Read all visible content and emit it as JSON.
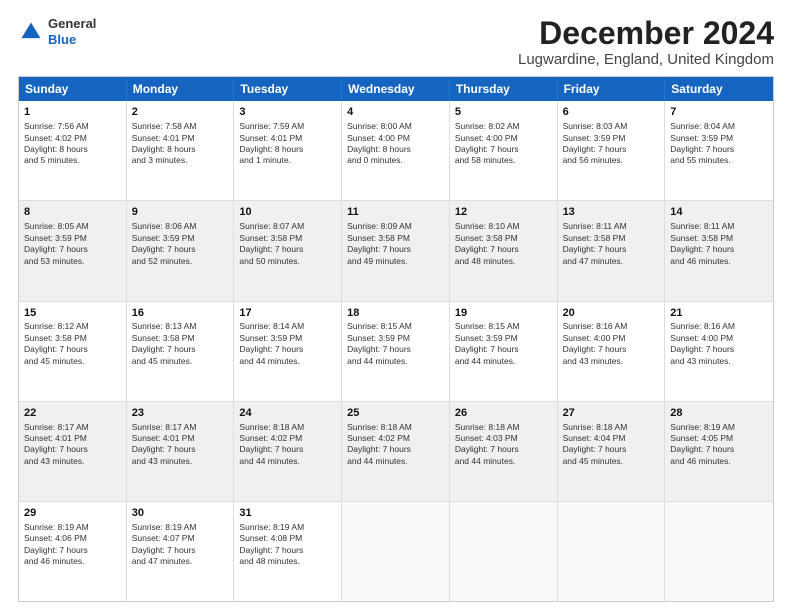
{
  "header": {
    "logo_line1": "General",
    "logo_line2": "Blue",
    "title": "December 2024",
    "subtitle": "Lugwardine, England, United Kingdom"
  },
  "calendar": {
    "weekdays": [
      "Sunday",
      "Monday",
      "Tuesday",
      "Wednesday",
      "Thursday",
      "Friday",
      "Saturday"
    ],
    "rows": [
      [
        {
          "day": "1",
          "lines": [
            "Sunrise: 7:56 AM",
            "Sunset: 4:02 PM",
            "Daylight: 8 hours",
            "and 5 minutes."
          ]
        },
        {
          "day": "2",
          "lines": [
            "Sunrise: 7:58 AM",
            "Sunset: 4:01 PM",
            "Daylight: 8 hours",
            "and 3 minutes."
          ]
        },
        {
          "day": "3",
          "lines": [
            "Sunrise: 7:59 AM",
            "Sunset: 4:01 PM",
            "Daylight: 8 hours",
            "and 1 minute."
          ]
        },
        {
          "day": "4",
          "lines": [
            "Sunrise: 8:00 AM",
            "Sunset: 4:00 PM",
            "Daylight: 8 hours",
            "and 0 minutes."
          ]
        },
        {
          "day": "5",
          "lines": [
            "Sunrise: 8:02 AM",
            "Sunset: 4:00 PM",
            "Daylight: 7 hours",
            "and 58 minutes."
          ]
        },
        {
          "day": "6",
          "lines": [
            "Sunrise: 8:03 AM",
            "Sunset: 3:59 PM",
            "Daylight: 7 hours",
            "and 56 minutes."
          ]
        },
        {
          "day": "7",
          "lines": [
            "Sunrise: 8:04 AM",
            "Sunset: 3:59 PM",
            "Daylight: 7 hours",
            "and 55 minutes."
          ]
        }
      ],
      [
        {
          "day": "8",
          "lines": [
            "Sunrise: 8:05 AM",
            "Sunset: 3:59 PM",
            "Daylight: 7 hours",
            "and 53 minutes."
          ]
        },
        {
          "day": "9",
          "lines": [
            "Sunrise: 8:06 AM",
            "Sunset: 3:59 PM",
            "Daylight: 7 hours",
            "and 52 minutes."
          ]
        },
        {
          "day": "10",
          "lines": [
            "Sunrise: 8:07 AM",
            "Sunset: 3:58 PM",
            "Daylight: 7 hours",
            "and 50 minutes."
          ]
        },
        {
          "day": "11",
          "lines": [
            "Sunrise: 8:09 AM",
            "Sunset: 3:58 PM",
            "Daylight: 7 hours",
            "and 49 minutes."
          ]
        },
        {
          "day": "12",
          "lines": [
            "Sunrise: 8:10 AM",
            "Sunset: 3:58 PM",
            "Daylight: 7 hours",
            "and 48 minutes."
          ]
        },
        {
          "day": "13",
          "lines": [
            "Sunrise: 8:11 AM",
            "Sunset: 3:58 PM",
            "Daylight: 7 hours",
            "and 47 minutes."
          ]
        },
        {
          "day": "14",
          "lines": [
            "Sunrise: 8:11 AM",
            "Sunset: 3:58 PM",
            "Daylight: 7 hours",
            "and 46 minutes."
          ]
        }
      ],
      [
        {
          "day": "15",
          "lines": [
            "Sunrise: 8:12 AM",
            "Sunset: 3:58 PM",
            "Daylight: 7 hours",
            "and 45 minutes."
          ]
        },
        {
          "day": "16",
          "lines": [
            "Sunrise: 8:13 AM",
            "Sunset: 3:58 PM",
            "Daylight: 7 hours",
            "and 45 minutes."
          ]
        },
        {
          "day": "17",
          "lines": [
            "Sunrise: 8:14 AM",
            "Sunset: 3:59 PM",
            "Daylight: 7 hours",
            "and 44 minutes."
          ]
        },
        {
          "day": "18",
          "lines": [
            "Sunrise: 8:15 AM",
            "Sunset: 3:59 PM",
            "Daylight: 7 hours",
            "and 44 minutes."
          ]
        },
        {
          "day": "19",
          "lines": [
            "Sunrise: 8:15 AM",
            "Sunset: 3:59 PM",
            "Daylight: 7 hours",
            "and 44 minutes."
          ]
        },
        {
          "day": "20",
          "lines": [
            "Sunrise: 8:16 AM",
            "Sunset: 4:00 PM",
            "Daylight: 7 hours",
            "and 43 minutes."
          ]
        },
        {
          "day": "21",
          "lines": [
            "Sunrise: 8:16 AM",
            "Sunset: 4:00 PM",
            "Daylight: 7 hours",
            "and 43 minutes."
          ]
        }
      ],
      [
        {
          "day": "22",
          "lines": [
            "Sunrise: 8:17 AM",
            "Sunset: 4:01 PM",
            "Daylight: 7 hours",
            "and 43 minutes."
          ]
        },
        {
          "day": "23",
          "lines": [
            "Sunrise: 8:17 AM",
            "Sunset: 4:01 PM",
            "Daylight: 7 hours",
            "and 43 minutes."
          ]
        },
        {
          "day": "24",
          "lines": [
            "Sunrise: 8:18 AM",
            "Sunset: 4:02 PM",
            "Daylight: 7 hours",
            "and 44 minutes."
          ]
        },
        {
          "day": "25",
          "lines": [
            "Sunrise: 8:18 AM",
            "Sunset: 4:02 PM",
            "Daylight: 7 hours",
            "and 44 minutes."
          ]
        },
        {
          "day": "26",
          "lines": [
            "Sunrise: 8:18 AM",
            "Sunset: 4:03 PM",
            "Daylight: 7 hours",
            "and 44 minutes."
          ]
        },
        {
          "day": "27",
          "lines": [
            "Sunrise: 8:18 AM",
            "Sunset: 4:04 PM",
            "Daylight: 7 hours",
            "and 45 minutes."
          ]
        },
        {
          "day": "28",
          "lines": [
            "Sunrise: 8:19 AM",
            "Sunset: 4:05 PM",
            "Daylight: 7 hours",
            "and 46 minutes."
          ]
        }
      ],
      [
        {
          "day": "29",
          "lines": [
            "Sunrise: 8:19 AM",
            "Sunset: 4:06 PM",
            "Daylight: 7 hours",
            "and 46 minutes."
          ]
        },
        {
          "day": "30",
          "lines": [
            "Sunrise: 8:19 AM",
            "Sunset: 4:07 PM",
            "Daylight: 7 hours",
            "and 47 minutes."
          ]
        },
        {
          "day": "31",
          "lines": [
            "Sunrise: 8:19 AM",
            "Sunset: 4:08 PM",
            "Daylight: 7 hours",
            "and 48 minutes."
          ]
        },
        {
          "day": "",
          "lines": []
        },
        {
          "day": "",
          "lines": []
        },
        {
          "day": "",
          "lines": []
        },
        {
          "day": "",
          "lines": []
        }
      ]
    ]
  }
}
